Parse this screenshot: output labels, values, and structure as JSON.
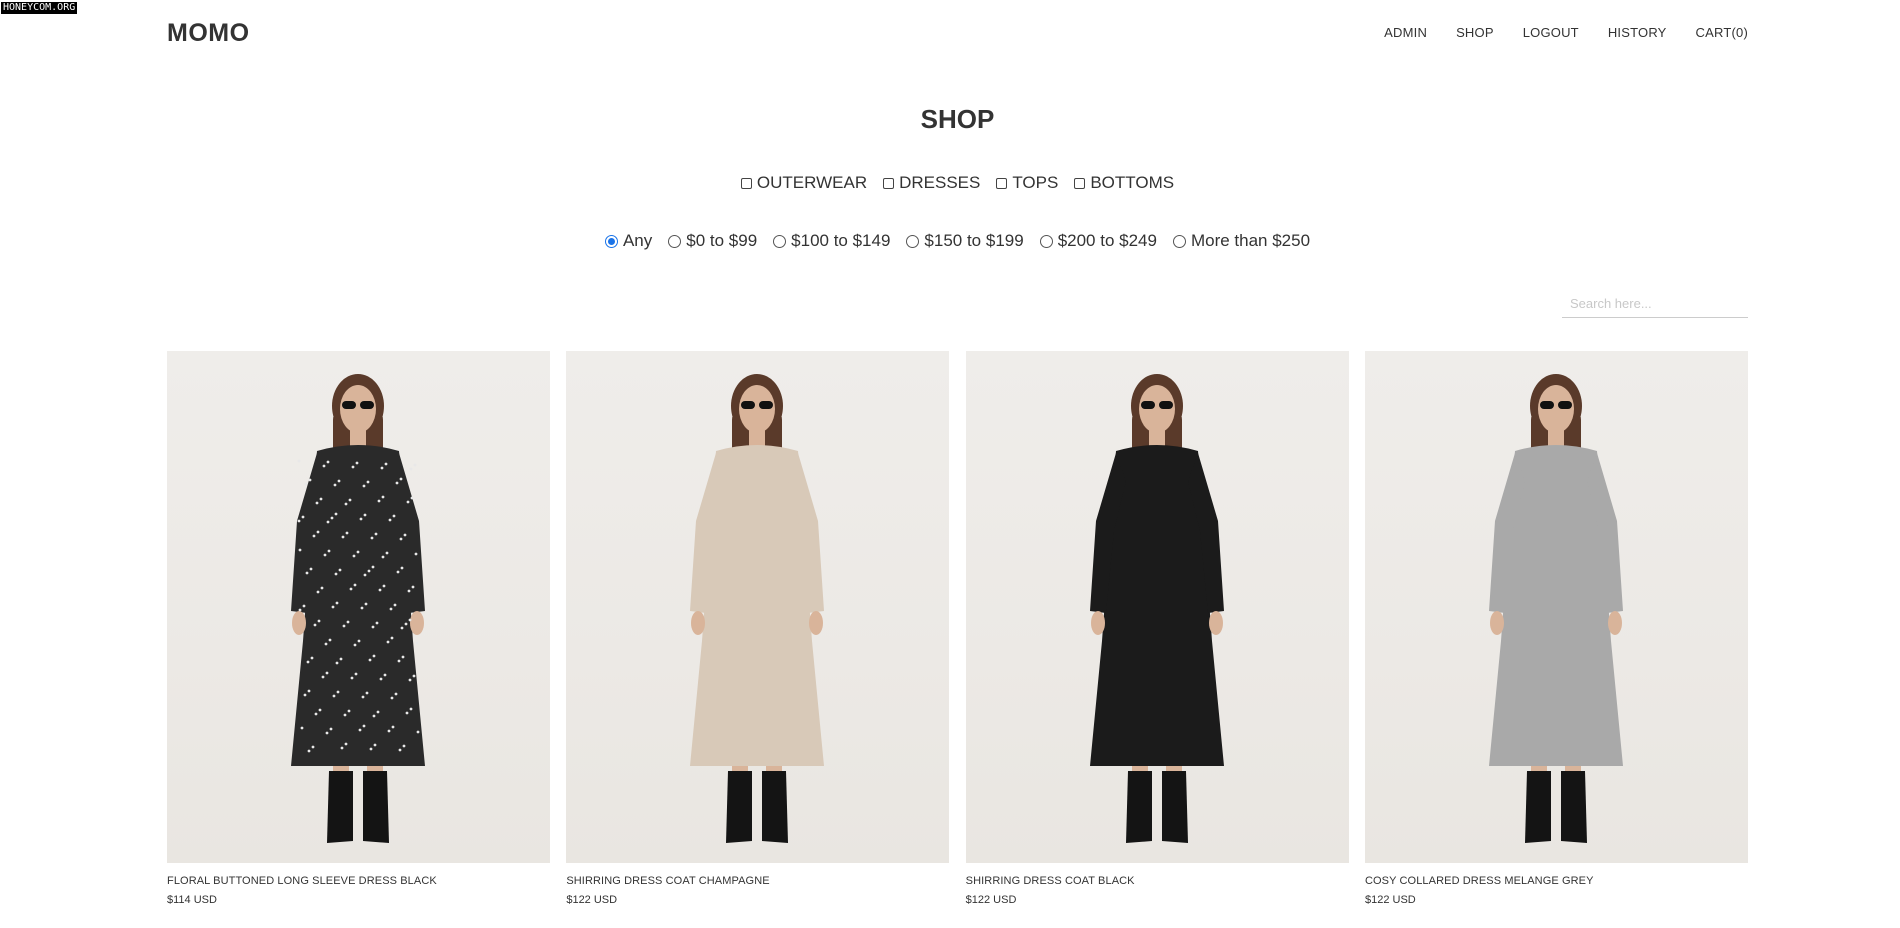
{
  "watermark": "HONEYCOM.ORG",
  "brand": "MOMO",
  "nav": [
    "ADMIN",
    "SHOP",
    "LOGOUT",
    "HISTORY",
    "CART(0)"
  ],
  "page_title": "SHOP",
  "categories": [
    "OUTERWEAR",
    "DRESSES",
    "TOPS",
    "BOTTOMS"
  ],
  "price_ranges": [
    "Any",
    "$0 to $99",
    "$100 to $149",
    "$150 to $199",
    "$200 to $249",
    "More than $250"
  ],
  "selected_price": "Any",
  "search": {
    "placeholder": "Search here...",
    "value": ""
  },
  "products": [
    {
      "name": "FLORAL BUTTONED LONG SLEEVE DRESS BLACK",
      "price": "$114 USD",
      "dress_color": "#2a2a2a",
      "pattern": "floral"
    },
    {
      "name": "SHIRRING DRESS COAT CHAMPAGNE",
      "price": "$122 USD",
      "dress_color": "#d8c9b8",
      "pattern": "plain"
    },
    {
      "name": "SHIRRING DRESS COAT BLACK",
      "price": "$122 USD",
      "dress_color": "#1b1b1b",
      "pattern": "plain"
    },
    {
      "name": "COSY COLLARED DRESS MELANGE GREY",
      "price": "$122 USD",
      "dress_color": "#a9a9a9",
      "pattern": "plain"
    }
  ]
}
